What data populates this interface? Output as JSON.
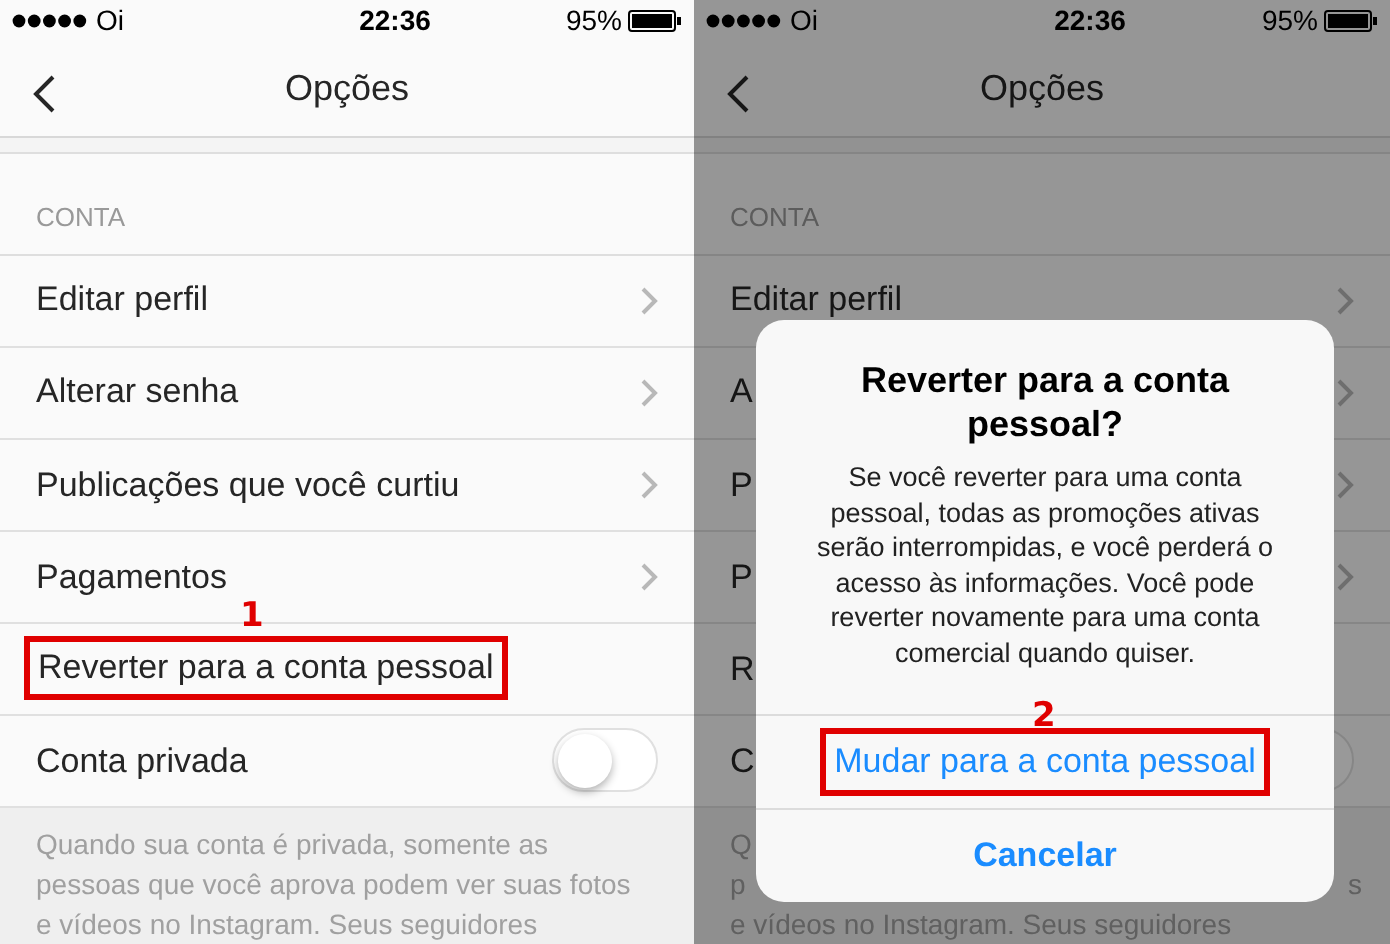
{
  "screens": [
    {
      "dimmed": false,
      "status_bar": {
        "carrier": "Oi",
        "time": "22:36",
        "battery": "95%"
      },
      "title": "Opções",
      "section_header": "CONTA",
      "rows": [
        {
          "kind": "link",
          "label": "Editar perfil"
        },
        {
          "kind": "link",
          "label": "Alterar senha"
        },
        {
          "kind": "link",
          "label": "Publicações que você curtiu"
        },
        {
          "kind": "link",
          "label": "Pagamentos"
        },
        {
          "kind": "plain",
          "label": "Reverter para a conta pessoal",
          "annotation": "1"
        },
        {
          "kind": "toggle",
          "label": "Conta privada",
          "on": false
        }
      ],
      "footer_lines": [
        {
          "left": "Quando sua conta é privada, somente as"
        },
        {
          "left": "pessoas que você aprova podem ver suas fotos"
        },
        {
          "left": "e vídeos no Instagram. Seus seguidores"
        }
      ]
    },
    {
      "dimmed": true,
      "status_bar": {
        "carrier": "Oi",
        "time": "22:36",
        "battery": "95%"
      },
      "title": "Opções",
      "section_header": "CONTA",
      "rows": [
        {
          "kind": "link",
          "label": "Editar perfil"
        },
        {
          "kind": "link",
          "label": "A"
        },
        {
          "kind": "link",
          "label": "P"
        },
        {
          "kind": "link",
          "label": "P"
        },
        {
          "kind": "plain",
          "label": "R"
        },
        {
          "kind": "toggle",
          "label": "C",
          "on": false
        }
      ],
      "footer_lines": [
        {
          "left": "Q"
        },
        {
          "left": "p",
          "right": "s"
        },
        {
          "left": "e vídeos no Instagram. Seus seguidores"
        }
      ],
      "dialog": {
        "title": "Reverter para a conta pessoal?",
        "message": "Se você reverter para uma conta\npessoal, todas as promoções ativas\nserão interrompidas, e você perderá o\nacesso às informações. Você pode\nreverter novamente para uma conta\ncomercial quando quiser.",
        "actions": [
          {
            "label": "Mudar para a conta pessoal",
            "bold": false,
            "annotation": "2"
          },
          {
            "label": "Cancelar",
            "bold": true
          }
        ]
      }
    }
  ]
}
